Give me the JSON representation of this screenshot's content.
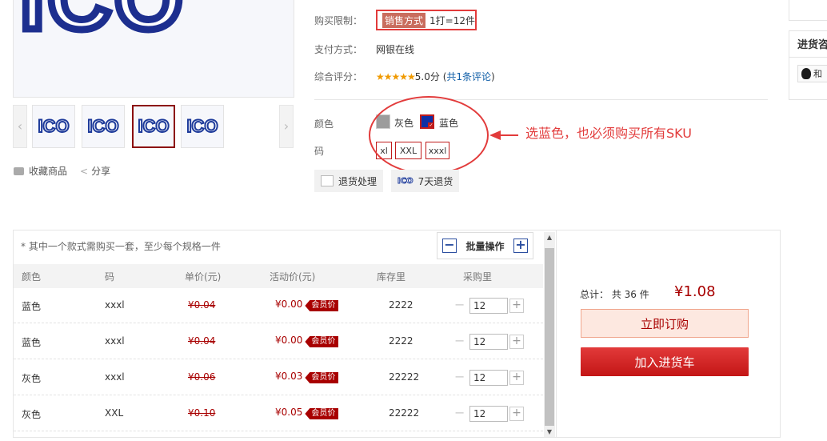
{
  "gallery": {
    "main_logo": "ICO",
    "thumbnails": [
      "ICO",
      "ICO",
      "ICO",
      "ICO"
    ],
    "selected_thumb": 2,
    "prev_arrow": "‹",
    "next_arrow": "›",
    "favorite_label": "收藏商品",
    "share_label": "分享"
  },
  "info": {
    "purchase_limit_label": "购买限制：",
    "sale_method_tag": "销售方式",
    "sale_method_value": "1打=12件",
    "payment_label": "支付方式：",
    "payment_value": "网银在线",
    "rating_label": "综合评分：",
    "rating_stars": "★★★★★",
    "rating_value": "5.0分",
    "review_open": "(",
    "review_link": "共1条评论",
    "review_close": ")"
  },
  "options": {
    "color_label": "颜色",
    "colors": [
      {
        "name": "灰色",
        "swatch": "#9c9c9c",
        "selected": false
      },
      {
        "name": "蓝色",
        "swatch": "#0e2fa5",
        "selected": true
      }
    ],
    "size_label": "码",
    "sizes": [
      "xl",
      "XXL",
      "xxxl"
    ],
    "annotation": "选蓝色，也必须购买所有SKU"
  },
  "services": [
    {
      "label": "退货处理"
    },
    {
      "label": "7天退货",
      "icon_text": "ICO"
    }
  ],
  "right_widget": {
    "title": "进货咨",
    "button_label": "和"
  },
  "sku_table": {
    "note": "* 其中一个款式需购买一套，至少每个规格一件",
    "batch_label": "批量操作",
    "batch_minus": "−",
    "batch_plus": "+",
    "headers": [
      "颜色",
      "码",
      "单价(元)",
      "活动价(元)",
      "库存里",
      "采购里"
    ],
    "member_tag": "会员价",
    "minus": "−",
    "plus": "+",
    "rows": [
      {
        "color": "蓝色",
        "size": "xxxl",
        "price": "¥0.04",
        "promo": "¥0.00",
        "stock": "2222",
        "qty": "12"
      },
      {
        "color": "蓝色",
        "size": "xxxl",
        "price": "¥0.04",
        "promo": "¥0.00",
        "stock": "2222",
        "qty": "12"
      },
      {
        "color": "灰色",
        "size": "xxxl",
        "price": "¥0.06",
        "promo": "¥0.03",
        "stock": "22222",
        "qty": "12"
      },
      {
        "color": "灰色",
        "size": "XXL",
        "price": "¥0.10",
        "promo": "¥0.05",
        "stock": "22222",
        "qty": "12"
      }
    ]
  },
  "summary": {
    "total_label": "总计：",
    "count_text": "共 36 件",
    "total_price": "¥1.08",
    "order_button": "立即订购",
    "cart_button": "加入进货车"
  },
  "colors": {
    "accent_red": "#a80000",
    "annotation_red": "#e23b3b",
    "logo_blue": "#1d2f8f"
  }
}
